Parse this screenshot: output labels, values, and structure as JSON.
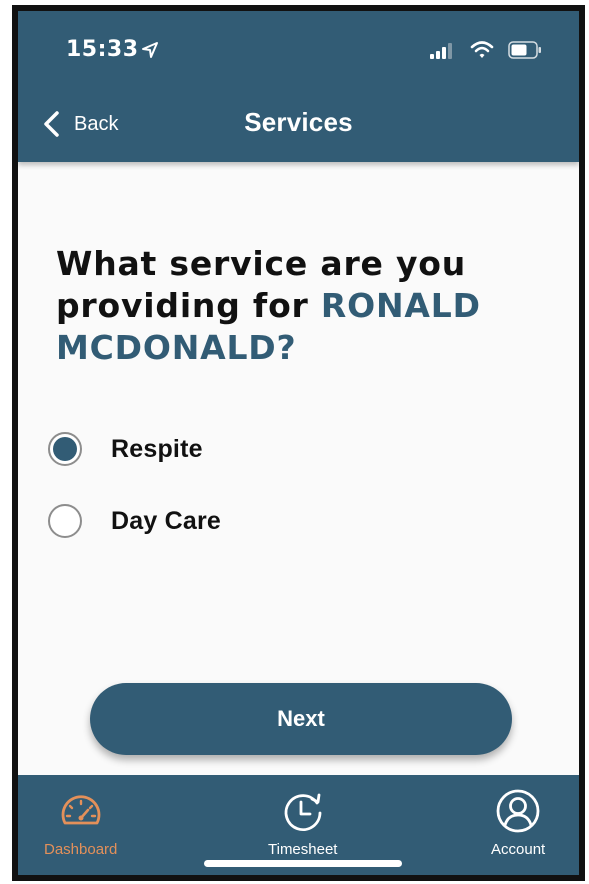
{
  "status_bar": {
    "time": "15:33"
  },
  "nav": {
    "back_label": "Back",
    "title": "Services"
  },
  "question": {
    "prefix": "What service are you providing for ",
    "client_name": "RONALD MCDONALD?"
  },
  "options": [
    {
      "label": "Respite",
      "selected": true
    },
    {
      "label": "Day Care",
      "selected": false
    }
  ],
  "next_button": {
    "label": "Next"
  },
  "tabs": [
    {
      "label": "Dashboard",
      "icon": "speedometer-icon",
      "active": true
    },
    {
      "label": "Timesheet",
      "icon": "clock-refresh-icon",
      "active": false
    },
    {
      "label": "Account",
      "icon": "user-circle-icon",
      "active": false
    }
  ],
  "colors": {
    "primary": "#325c75",
    "active_tab": "#e3905a",
    "background": "#fafafa"
  }
}
